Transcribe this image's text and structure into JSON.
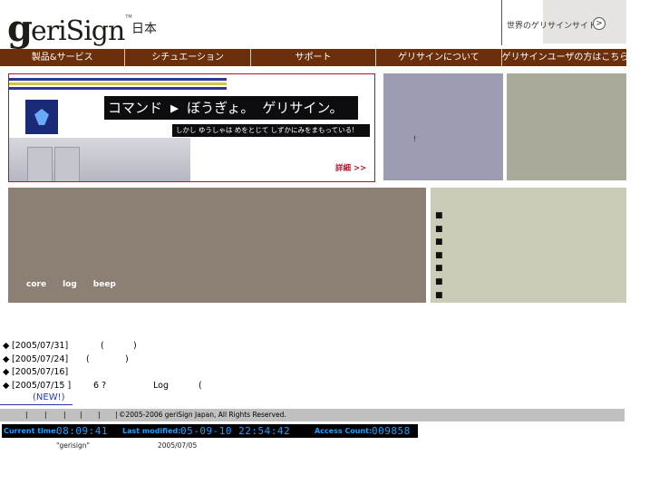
{
  "header": {
    "logo_initial": "g",
    "logo_rest": "eriSign",
    "logo_tm": "TM",
    "region": "日本",
    "world_link_label": "世界のゲリサインサイト",
    "world_link_arrow": ">"
  },
  "nav": {
    "items": [
      "製品&サービス",
      "シチュエーション",
      "サポート",
      "ゲリサインについて",
      "ゲリサインユーザの方はこちら"
    ]
  },
  "banner": {
    "headline": "コマンド ▶ ぼうぎょ。 ゲリサイン。",
    "subline": "しかし ゆうしゃは めをとじて しずかにみをまもっている!",
    "detail_link": "詳細 >>"
  },
  "side_box": {
    "mark": "!"
  },
  "feature": {
    "links": [
      "core",
      "log",
      "beep"
    ]
  },
  "bullets": {
    "items": [
      "■",
      "■",
      "■",
      "■",
      "■",
      "■",
      "■"
    ]
  },
  "news": {
    "rows": [
      {
        "diamond": "◆",
        "date": "[2005/07/31]",
        "a": "(",
        "b": ")"
      },
      {
        "diamond": "◆",
        "date": "[2005/07/24]",
        "a": "(",
        "b": ")"
      },
      {
        "diamond": "◆",
        "date": "[2005/07/16]"
      },
      {
        "diamond": "◆",
        "date": "[2005/07/15 ]",
        "a": "6 ?",
        "b": "Log",
        "c": "("
      }
    ],
    "new_label": "(NEW!)"
  },
  "footer": {
    "separators": [
      "|",
      "|",
      "|",
      "|",
      "|",
      "|"
    ],
    "copyright": "©2005-2006 geriSign Japan, All Rights Reserved."
  },
  "counter": {
    "current_time_label": "Current time:",
    "current_time_value": "08:09:41",
    "last_modified_label": "Last modified:",
    "last_modified_value": "05-09-10 22:54:42",
    "access_count_label": "Access Count:",
    "access_count_value": "009858"
  },
  "bottom": {
    "name": "\"gerisign\"",
    "date": "2005/07/05"
  }
}
